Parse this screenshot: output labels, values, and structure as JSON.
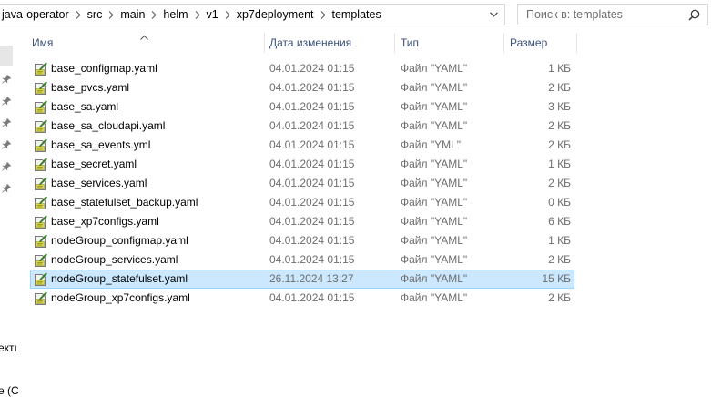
{
  "address": {
    "crumbs": [
      "java-operator",
      "src",
      "main",
      "helm",
      "v1",
      "xp7deployment",
      "templates"
    ]
  },
  "search": {
    "placeholder": "Поиск в: templates"
  },
  "navpane": {
    "cut_labels": [
      "ектı",
      "е (С"
    ]
  },
  "columns": {
    "name": "Имя",
    "date": "Дата изменения",
    "type": "Тип",
    "size": "Размер",
    "sort": "name-ascending"
  },
  "files": [
    {
      "name": "base_configmap.yaml",
      "date": "04.01.2024 01:15",
      "type": "Файл \"YAML\"",
      "size": "1 КБ",
      "icon": "yaml-file-icon"
    },
    {
      "name": "base_pvcs.yaml",
      "date": "04.01.2024 01:15",
      "type": "Файл \"YAML\"",
      "size": "2 КБ",
      "icon": "yaml-file-icon"
    },
    {
      "name": "base_sa.yaml",
      "date": "04.01.2024 01:15",
      "type": "Файл \"YAML\"",
      "size": "3 КБ",
      "icon": "yaml-file-icon"
    },
    {
      "name": "base_sa_cloudapi.yaml",
      "date": "04.01.2024 01:15",
      "type": "Файл \"YAML\"",
      "size": "2 КБ",
      "icon": "yaml-file-icon"
    },
    {
      "name": "base_sa_events.yml",
      "date": "04.01.2024 01:15",
      "type": "Файл \"YML\"",
      "size": "2 КБ",
      "icon": "yaml-file-icon"
    },
    {
      "name": "base_secret.yaml",
      "date": "04.01.2024 01:15",
      "type": "Файл \"YAML\"",
      "size": "1 КБ",
      "icon": "yaml-file-icon"
    },
    {
      "name": "base_services.yaml",
      "date": "04.01.2024 01:15",
      "type": "Файл \"YAML\"",
      "size": "2 КБ",
      "icon": "yaml-file-icon"
    },
    {
      "name": "base_statefulset_backup.yaml",
      "date": "04.01.2024 01:15",
      "type": "Файл \"YAML\"",
      "size": "0 КБ",
      "icon": "yaml-file-icon"
    },
    {
      "name": "base_xp7configs.yaml",
      "date": "04.01.2024 01:15",
      "type": "Файл \"YAML\"",
      "size": "6 КБ",
      "icon": "yaml-file-icon"
    },
    {
      "name": "nodeGroup_configmap.yaml",
      "date": "04.01.2024 01:15",
      "type": "Файл \"YAML\"",
      "size": "1 КБ",
      "icon": "yaml-file-icon"
    },
    {
      "name": "nodeGroup_services.yaml",
      "date": "04.01.2024 01:15",
      "type": "Файл \"YAML\"",
      "size": "2 КБ",
      "icon": "yaml-file-icon"
    },
    {
      "name": "nodeGroup_statefulset.yaml",
      "date": "26.11.2024 13:27",
      "type": "Файл \"YAML\"",
      "size": "15 КБ",
      "icon": "yaml-file-icon",
      "selected": true
    },
    {
      "name": "nodeGroup_xp7configs.yaml",
      "date": "04.01.2024 01:15",
      "type": "Файл \"YAML\"",
      "size": "2 КБ",
      "icon": "yaml-file-icon"
    }
  ],
  "colors": {
    "selection_fill": "#cce8ff",
    "selection_border": "#99d1ff",
    "header_text": "#3c5078",
    "secondary_text": "#6d6d6d"
  }
}
